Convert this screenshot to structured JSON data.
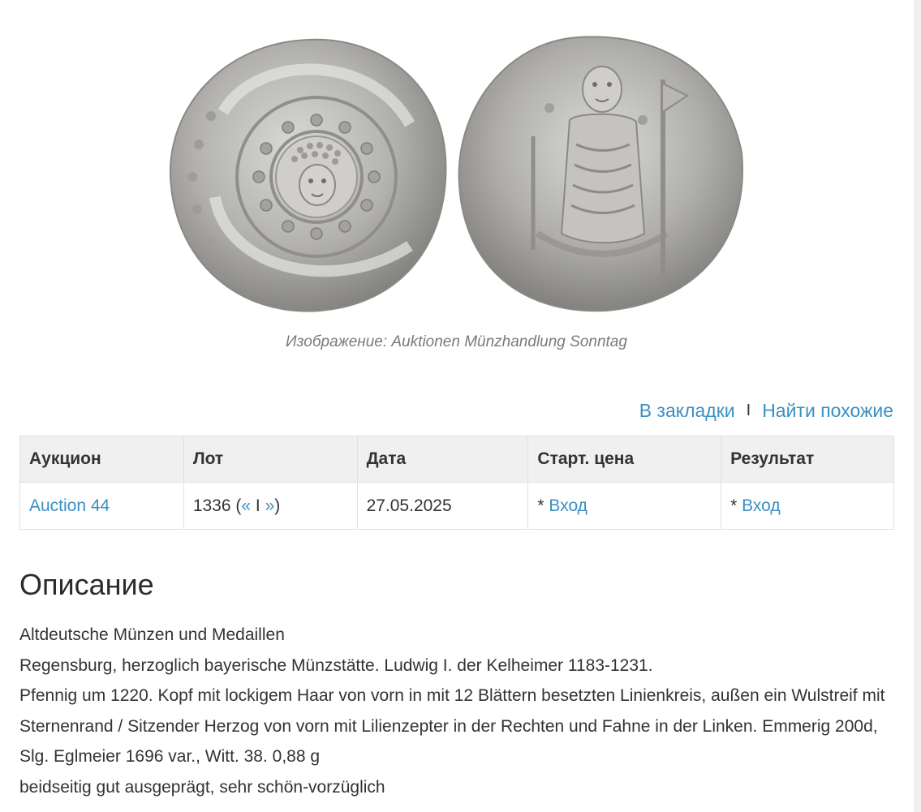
{
  "image": {
    "caption": "Изображение: Auktionen Münzhandlung Sonntag",
    "obverse_icon": "coin-obverse-icon",
    "reverse_icon": "coin-reverse-icon"
  },
  "actions": {
    "bookmark": "В закладки",
    "separator": "I",
    "find_similar": "Найти похожие"
  },
  "table": {
    "headers": [
      "Аукцион",
      "Лот",
      "Дата",
      "Старт. цена",
      "Результат"
    ],
    "row": {
      "auction": "Auction 44",
      "lot_number": "1336 (",
      "prev": "«",
      "lot_sep": " I ",
      "next": "»",
      "lot_close": ")",
      "date": "27.05.2025",
      "start_price_prefix": "* ",
      "start_price_link": "Вход",
      "result_prefix": "* ",
      "result_link": "Вход"
    }
  },
  "description": {
    "title": "Описание",
    "lines": [
      "Altdeutsche Münzen und Medaillen",
      "Regensburg, herzoglich bayerische Münzstätte. Ludwig I. der Kelheimer 1183-1231.",
      "Pfennig um 1220. Kopf mit lockigem Haar von vorn in mit 12 Blättern besetzten Linienkreis, außen ein Wulstreif mit Sternenrand / Sitzender Herzog von vorn mit Lilienzepter in der Rechten und Fahne in der Linken. Emmerig 200d, Slg. Eglmeier 1696 var., Witt. 38. 0,88 g",
      "beidseitig gut ausgeprägt, sehr schön-vorzüglich"
    ]
  },
  "colors": {
    "link": "#3a8fc3",
    "header_bg": "#f0f0f0",
    "text": "#333333",
    "caption": "#7a7a7a"
  }
}
